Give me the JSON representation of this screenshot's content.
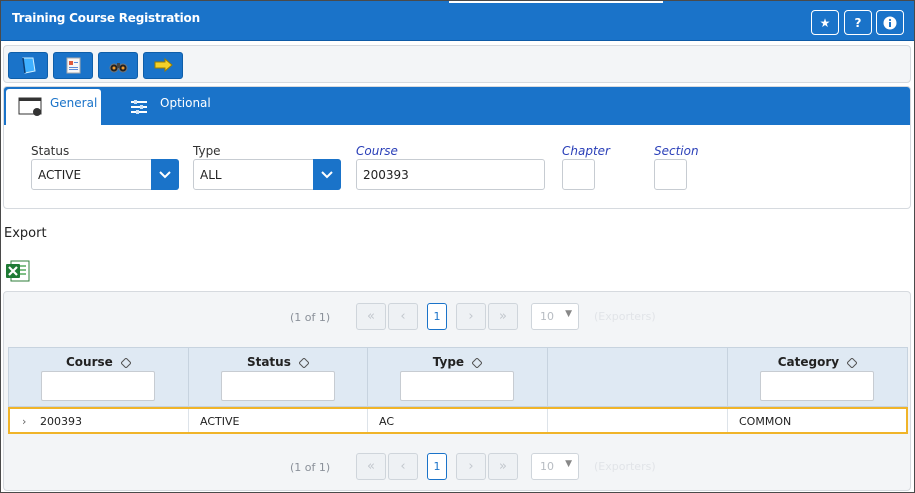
{
  "window": {
    "title": "Training Course Registration",
    "header_buttons": {
      "favorite": "★",
      "help": "?",
      "info": "i"
    }
  },
  "toolbar": {
    "buttons": [
      "new-record",
      "report",
      "search",
      "save"
    ]
  },
  "tabs": [
    {
      "label": "General",
      "active": true
    },
    {
      "label": "Optional",
      "active": false
    }
  ],
  "form": {
    "status": {
      "label": "Status",
      "value": "ACTIVE"
    },
    "type": {
      "label": "Type",
      "value": "ALL"
    },
    "course": {
      "label": "Course",
      "value": "200393"
    },
    "chapter": {
      "label": "Chapter",
      "value": ""
    },
    "section": {
      "label": "Section",
      "value": ""
    }
  },
  "export": {
    "label": "Export",
    "icon": "excel-icon"
  },
  "grid": {
    "pager_top": {
      "count": "(1 of 1)",
      "page": "1",
      "rows": "10",
      "exporters": "(Exporters)"
    },
    "pager_bottom": {
      "count": "(1 of 1)",
      "page": "1",
      "rows": "10",
      "exporters": "(Exporters)"
    },
    "columns": [
      "Course",
      "Status",
      "Type",
      "",
      "Category"
    ],
    "rows": [
      {
        "course": "200393",
        "status": "ACTIVE",
        "type": "AC",
        "blank": "",
        "category": "COMMON"
      }
    ]
  },
  "colors": {
    "primary": "#1a73c9",
    "selection": "#f0b429",
    "header_bg": "#dfe9f3"
  }
}
